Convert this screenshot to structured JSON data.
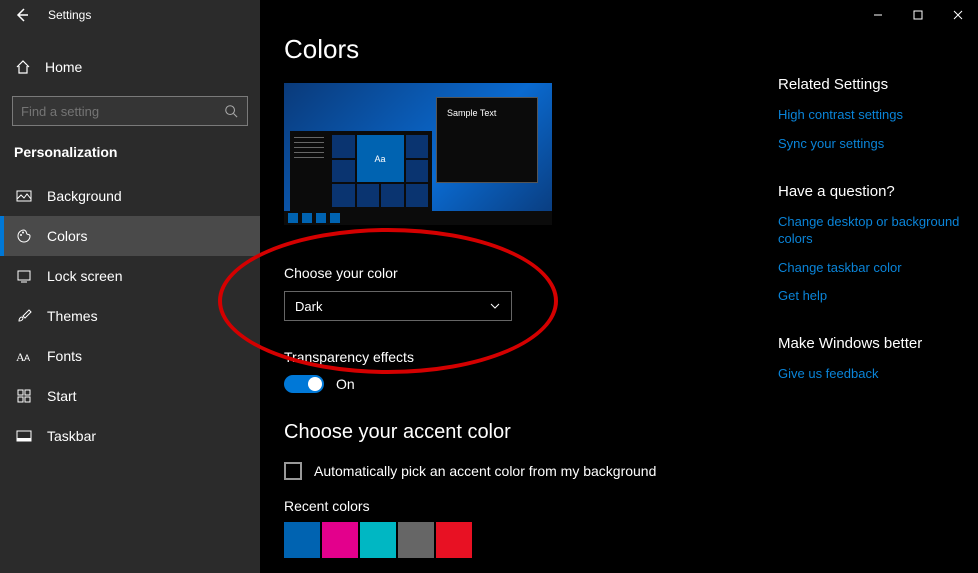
{
  "app_title": "Settings",
  "search": {
    "placeholder": "Find a setting"
  },
  "home_label": "Home",
  "section": "Personalization",
  "nav": [
    {
      "id": "background",
      "label": "Background"
    },
    {
      "id": "colors",
      "label": "Colors"
    },
    {
      "id": "lockscreen",
      "label": "Lock screen"
    },
    {
      "id": "themes",
      "label": "Themes"
    },
    {
      "id": "fonts",
      "label": "Fonts"
    },
    {
      "id": "start",
      "label": "Start"
    },
    {
      "id": "taskbar",
      "label": "Taskbar"
    }
  ],
  "page": {
    "title": "Colors",
    "preview_sample": "Sample Text",
    "preview_tile_text": "Aa",
    "choose_color_label": "Choose your color",
    "choose_color_value": "Dark",
    "transparency_label": "Transparency effects",
    "transparency_state": "On",
    "accent_heading": "Choose your accent color",
    "auto_pick_label": "Automatically pick an accent color from my background",
    "recent_label": "Recent colors",
    "recent_colors": [
      "#0063b1",
      "#e3008c",
      "#00b7c3",
      "#666666",
      "#e81123"
    ]
  },
  "right": {
    "related_heading": "Related Settings",
    "related_links": [
      "High contrast settings",
      "Sync your settings"
    ],
    "question_heading": "Have a question?",
    "question_links": [
      "Change desktop or background colors",
      "Change taskbar color",
      "Get help"
    ],
    "better_heading": "Make Windows better",
    "better_links": [
      "Give us feedback"
    ]
  }
}
